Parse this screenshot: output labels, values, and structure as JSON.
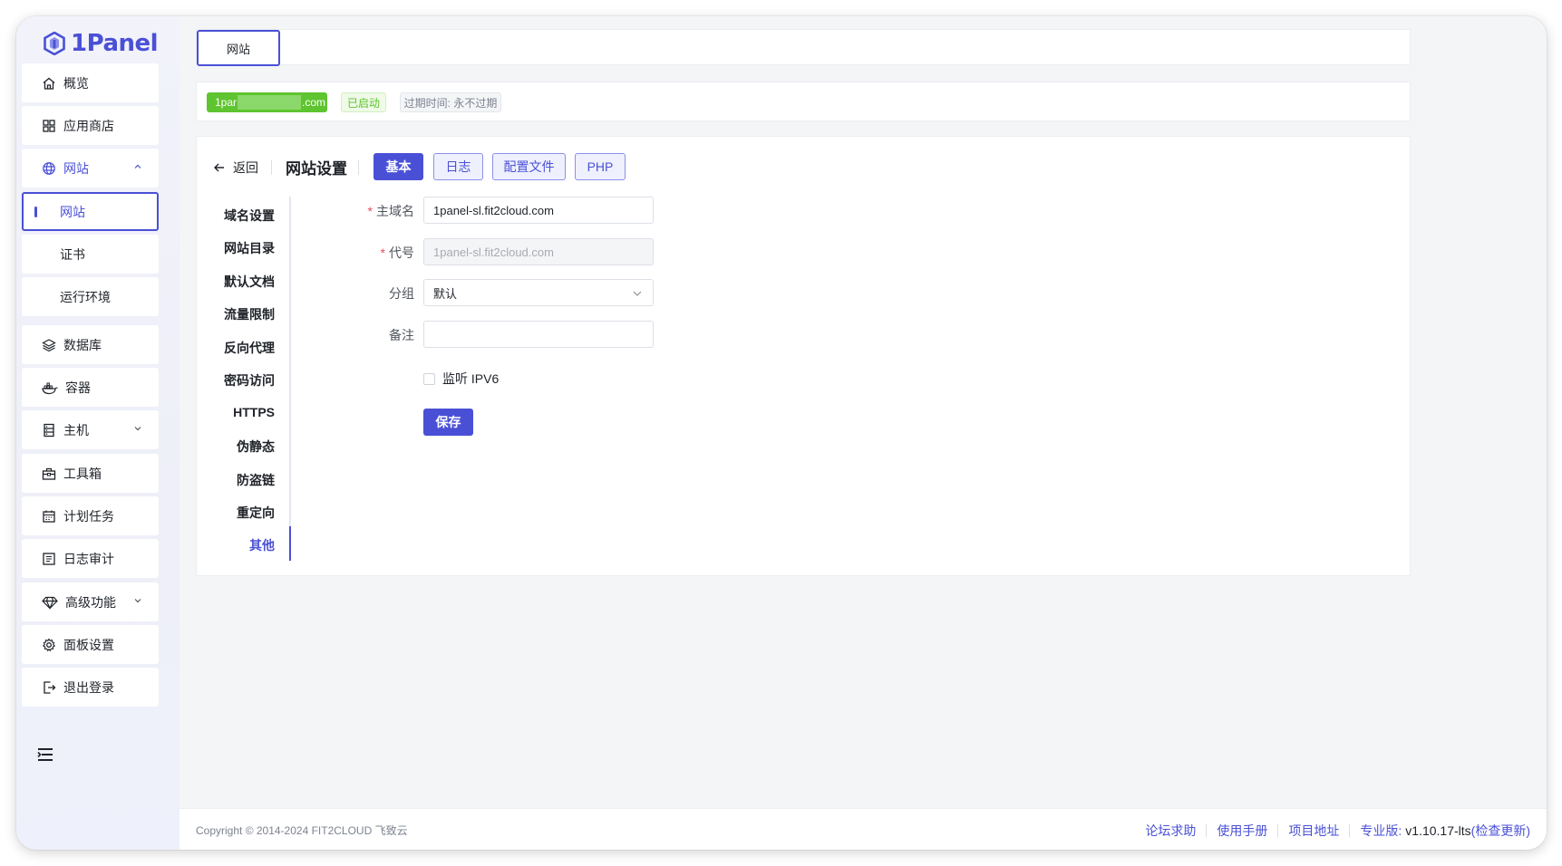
{
  "app": {
    "brand": "1Panel",
    "accent": "#4a50d6"
  },
  "sidebar": {
    "items": [
      {
        "label": "概览"
      },
      {
        "label": "应用商店"
      },
      {
        "label": "网站"
      },
      {
        "label": "网站"
      },
      {
        "label": "证书"
      },
      {
        "label": "运行环境"
      },
      {
        "label": "数据库"
      },
      {
        "label": "容器"
      },
      {
        "label": "主机"
      },
      {
        "label": "工具箱"
      },
      {
        "label": "计划任务"
      },
      {
        "label": "日志审计"
      },
      {
        "label": "高级功能"
      },
      {
        "label": "面板设置"
      },
      {
        "label": "退出登录"
      }
    ]
  },
  "tabs": {
    "site": "网站"
  },
  "info": {
    "domain_prefix": "1par",
    "domain_suffix": ".com",
    "status": "已启动",
    "expire": "过期时间: 永不过期"
  },
  "panel": {
    "back": "返回",
    "title": "网站设置",
    "buttons": [
      "基本",
      "日志",
      "配置文件",
      "PHP"
    ],
    "nav": [
      "域名设置",
      "网站目录",
      "默认文档",
      "流量限制",
      "反向代理",
      "密码访问",
      "HTTPS",
      "伪静态",
      "防盗链",
      "重定向",
      "其他"
    ],
    "form": {
      "primary_domain_label": "主域名",
      "primary_domain_value": "1panel-sl.fit2cloud.com",
      "alias_label": "代号",
      "alias_value": "1panel-sl.fit2cloud.com",
      "group_label": "分组",
      "group_value": "默认",
      "remark_label": "备注",
      "remark_value": "",
      "ipv6_label": "监听 IPV6",
      "ipv6_checked": false,
      "save": "保存"
    }
  },
  "footer": {
    "copyright": "Copyright © 2014-2024 FIT2CLOUD 飞致云",
    "links": [
      "论坛求助",
      "使用手册",
      "项目地址"
    ],
    "edition": "专业版:",
    "version": "v1.10.17-lts",
    "check_update": "(检查更新)"
  }
}
